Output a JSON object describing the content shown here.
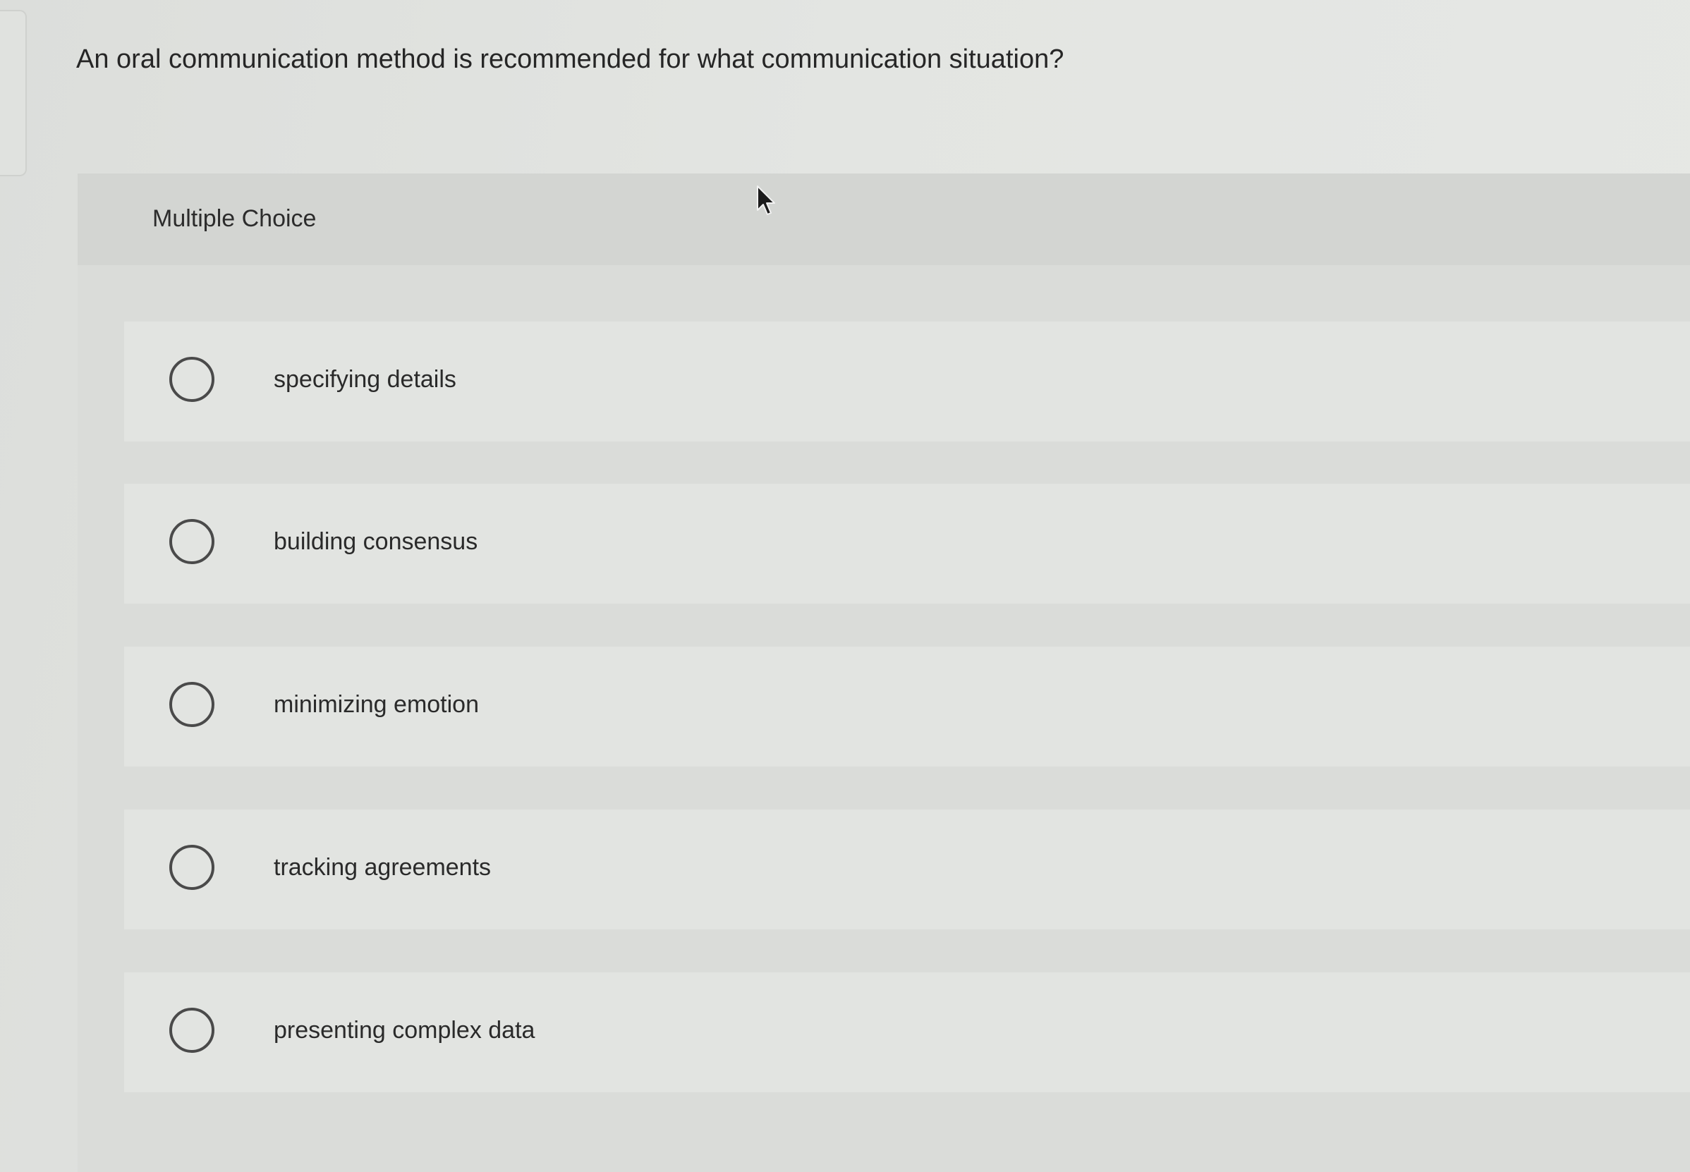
{
  "question": {
    "text": "An oral communication method is recommended for what communication situation?"
  },
  "panel": {
    "header_label": "Multiple Choice"
  },
  "options": [
    {
      "label": "specifying details",
      "selected": false
    },
    {
      "label": "building consensus",
      "selected": false
    },
    {
      "label": "minimizing emotion",
      "selected": false
    },
    {
      "label": "tracking agreements",
      "selected": false
    },
    {
      "label": "presenting complex data",
      "selected": false
    }
  ],
  "icons": {
    "radio": "radio-button-icon",
    "cursor": "mouse-pointer-icon"
  },
  "colors": {
    "background": "#e3e5e2",
    "panel": "#dadcd9",
    "header": "#d3d5d2",
    "option": "#e2e4e1",
    "text": "#2a2a2a",
    "radio_border": "#4a4a4a"
  }
}
